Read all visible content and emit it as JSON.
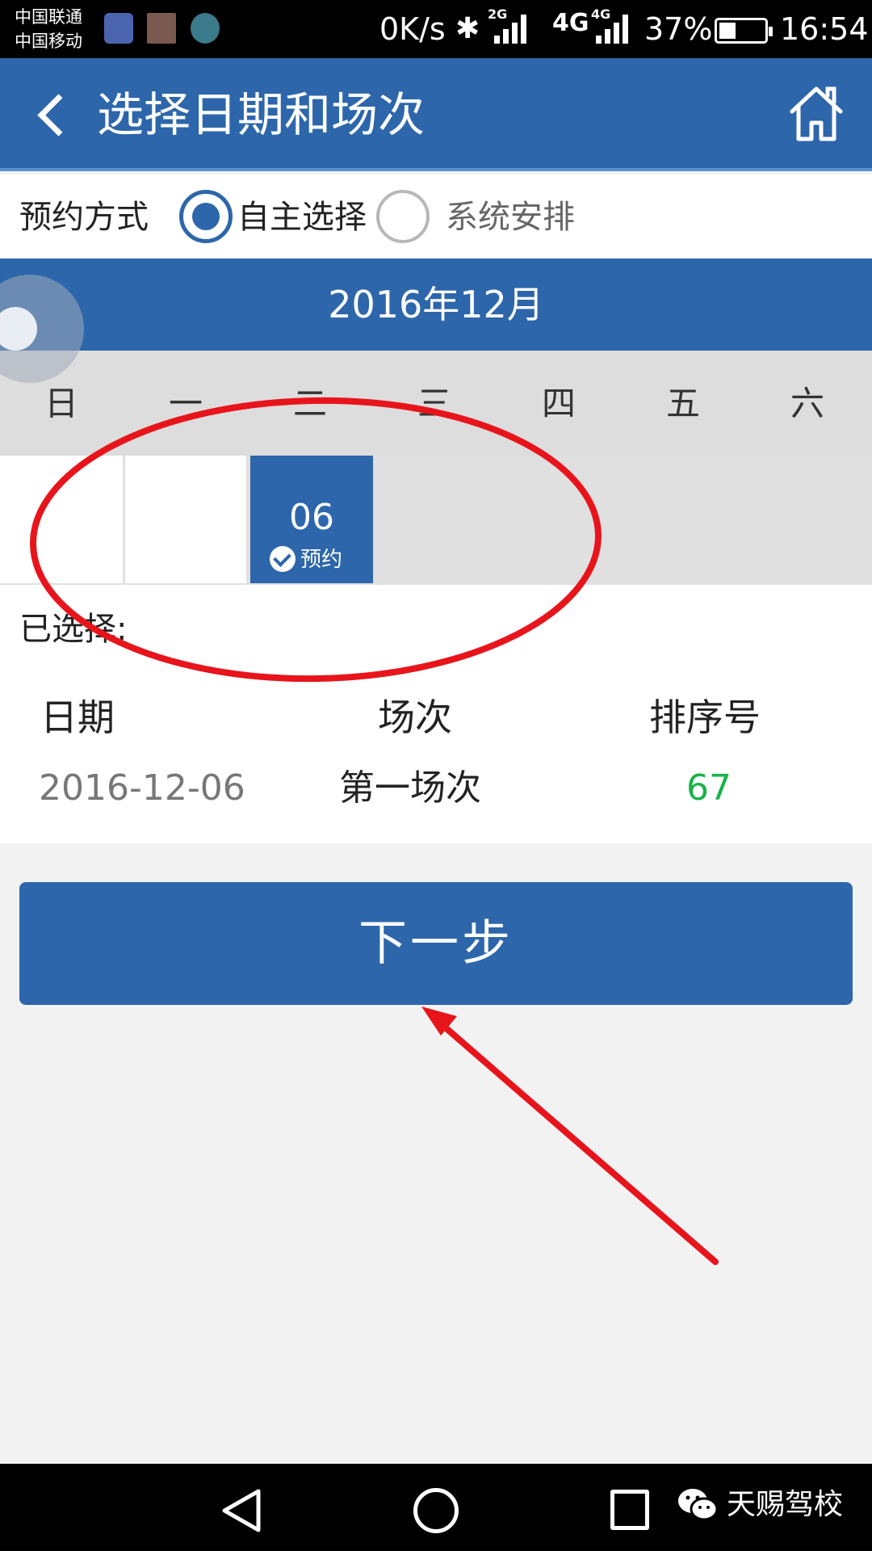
{
  "status_bar": {
    "carrier1": "中国联通",
    "carrier2": "中国移动",
    "speed": "0K/s",
    "net1": "2G",
    "net2_big": "4G",
    "net2_small": "4G",
    "battery_pct": "37%",
    "battery_level": 0.37,
    "time": "16:54"
  },
  "header": {
    "title": "选择日期和场次",
    "back_icon": "chevron-left-icon",
    "home_icon": "home-icon"
  },
  "method": {
    "label": "预约方式",
    "options": [
      {
        "label": "自主选择",
        "checked": true
      },
      {
        "label": "系统安排",
        "checked": false
      }
    ]
  },
  "calendar": {
    "month": "2016年12月",
    "weekdays": [
      "日",
      "一",
      "二",
      "三",
      "四",
      "五",
      "六"
    ],
    "selected_day": "06",
    "selected_tag": "预约"
  },
  "selection": {
    "label": "已选择:",
    "headers": [
      "日期",
      "场次",
      "排序号"
    ],
    "row": [
      "2016-12-06",
      "第一场次",
      "67"
    ],
    "accent_color": "#1ab24a"
  },
  "next_button": {
    "label": "下一步"
  },
  "watermark": {
    "text": "天赐驾校",
    "icon": "wechat-icon"
  },
  "colors": {
    "primary": "#2d66aa",
    "annotation": "#e8141c"
  }
}
